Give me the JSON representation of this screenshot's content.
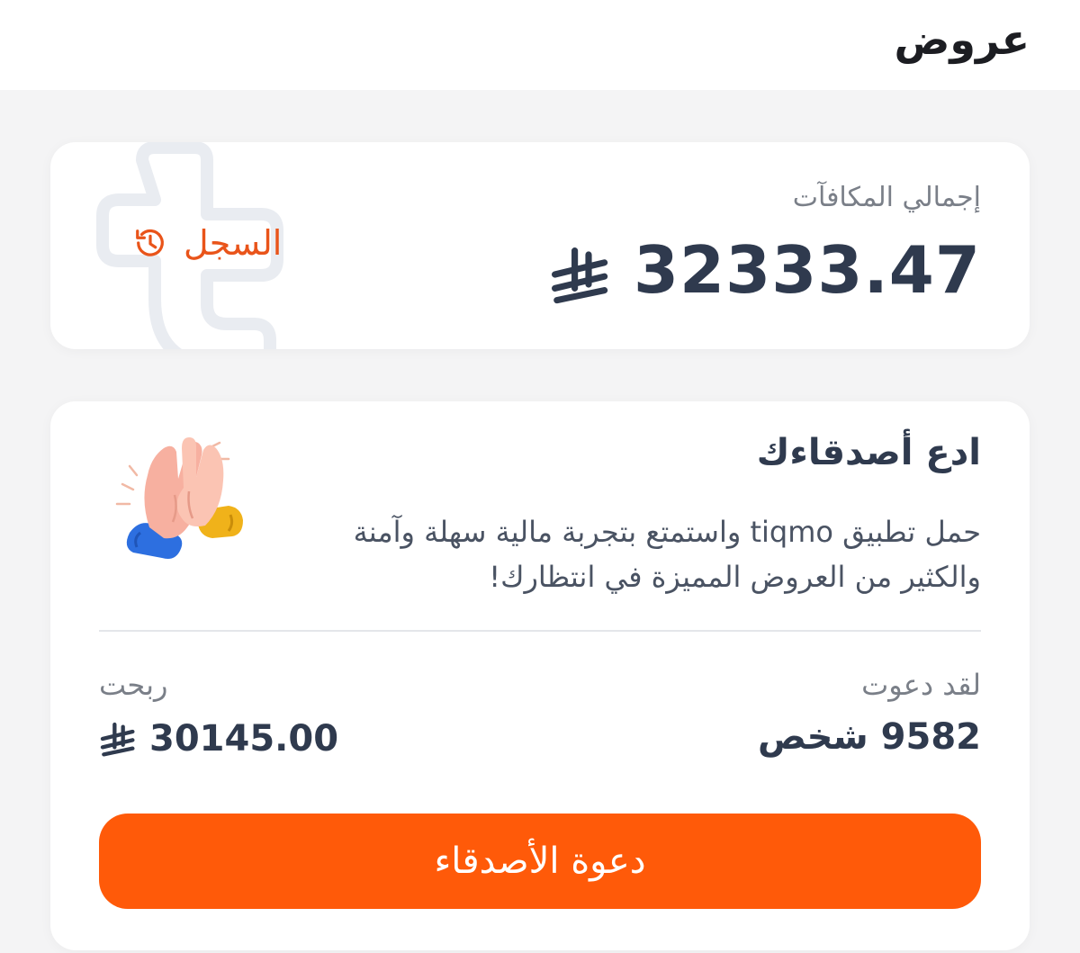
{
  "header": {
    "title": "عروض"
  },
  "rewards": {
    "label": "إجمالي المكافآت",
    "total": "32333.47",
    "currency_icon": "saudi-riyal-icon",
    "history_label": "السجل",
    "history_icon": "history-clock-icon",
    "watermark_icon": "tiqmo-logo-watermark"
  },
  "invite": {
    "title": "ادع أصدقاءك",
    "description": "حمل تطبيق tiqmo واستمتع بتجربة مالية سهلة وآمنة والكثير من العروض المميزة في انتظارك!",
    "illustration_icon": "high-five-hands-icon",
    "invited_label": "لقد دعوت",
    "invited_value": "9582 شخص",
    "earned_label": "ربحت",
    "earned_value": "30145.00",
    "button_label": "دعوة الأصدقاء"
  },
  "colors": {
    "accent": "#ff5a09",
    "history_text": "#e9541a",
    "primary_text": "#2f3a4e",
    "secondary_text": "#7a7f88",
    "background": "#f4f4f5",
    "card": "#ffffff"
  }
}
